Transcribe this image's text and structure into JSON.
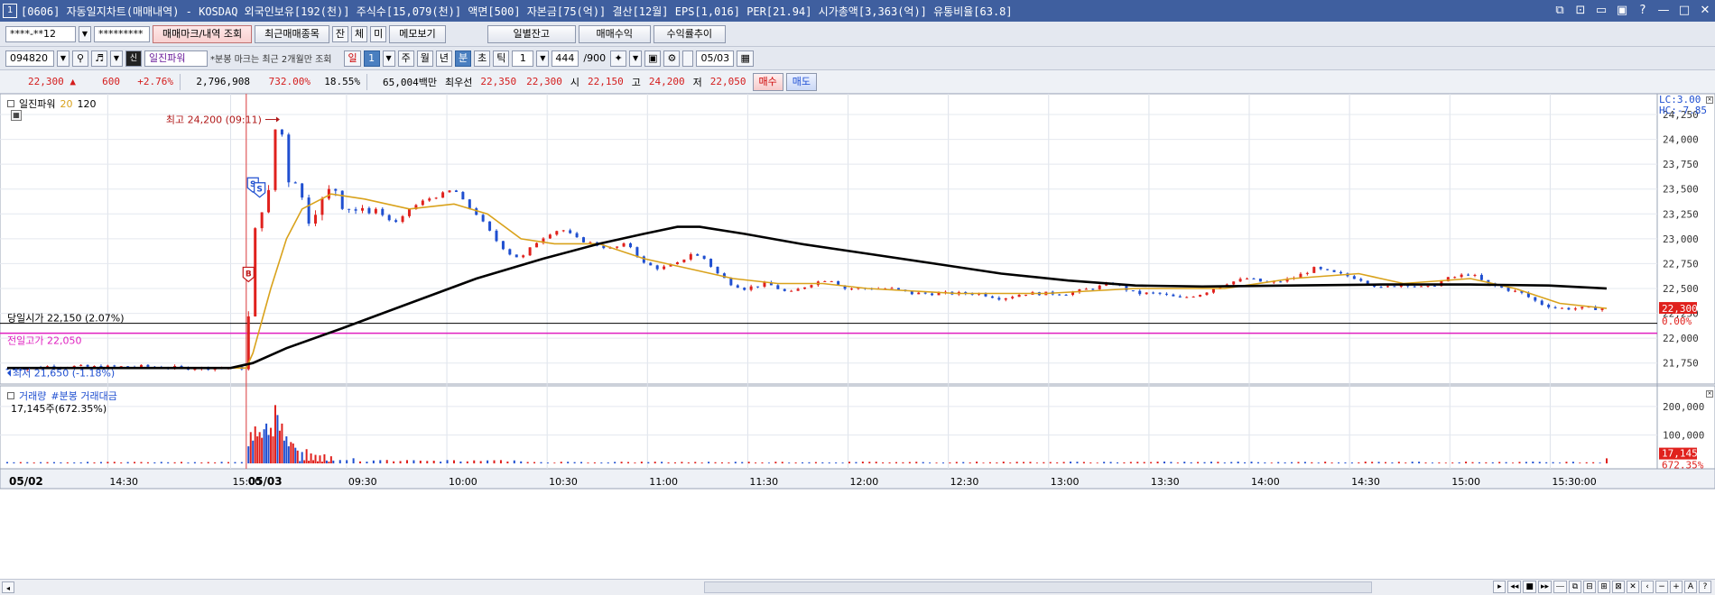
{
  "window": {
    "number": "1",
    "title": "[0606] 자동일지차트(매매내역) - KOSDAQ 외국인보유[192(천)] 주식수[15,079(천)] 액면[500] 자본금[75(억)] 결산[12월] EPS[1,016] PER[21.94] 시가총액[3,363(억)] 유통비율[63.8]",
    "controls": [
      "⧉",
      "⊡",
      "▭",
      "▣",
      "?",
      "—",
      "□",
      "✕"
    ]
  },
  "toolbar1": {
    "account": "****-**12",
    "password": "*********",
    "buttons": [
      "매매마크/내역 조회",
      "최근매매종목",
      "잔",
      "체",
      "미",
      "메모보기"
    ],
    "right_buttons": [
      "일별잔고",
      "매매수익",
      "수익률추이"
    ]
  },
  "toolbar2": {
    "code": "094820",
    "name": "일진파워",
    "note": "*분봉 마크는 최근 2개월만 조회",
    "period": "일",
    "period_num": "1",
    "period_tabs": [
      "주",
      "월",
      "년",
      "분",
      "초",
      "틱"
    ],
    "interval": "1",
    "count": "444",
    "count_total": "/900",
    "date": "05/03"
  },
  "quote": {
    "price": "22,300 ▲",
    "change": "600",
    "change_pct": "+2.76%",
    "volume": "2,796,908",
    "volume_ratio": "732.00%",
    "turnover_ratio": "18.55%",
    "amount": "65,004백만",
    "best_label": "최우선",
    "ask": "22,350",
    "bid": "22,300",
    "open_label": "시",
    "open": "22,150",
    "high_label": "고",
    "high": "24,200",
    "low_label": "저",
    "low": "22,050",
    "buy_button": "매수",
    "sell_button": "매도"
  },
  "colors": {
    "up": "#e0211d",
    "down": "#1f4fd0",
    "ma20": "#d9a21b",
    "ma120": "#000000",
    "prev_high_line": "#e020c0",
    "today_open_line": "#000000",
    "cursor_line": "#e04040",
    "accent_titlebar": "#3f5f9f"
  },
  "chart_data": [
    {
      "type": "candlestick",
      "title": "일진파워",
      "legend": [
        "20",
        "120"
      ],
      "ylim": [
        21575,
        24350
      ],
      "y_ticks": [
        24250,
        24000,
        23750,
        23500,
        23250,
        23000,
        22750,
        22500,
        22250,
        22000,
        21750
      ],
      "y_tick_labels": [
        "24,250",
        "24,000",
        "23,750",
        "23,500",
        "23,250",
        "23,000",
        "22,750",
        "22,500",
        "22,250",
        "22,000",
        "21,750"
      ],
      "x_labels": [
        {
          "t": "05/02 00",
          "label": "05/02"
        },
        {
          "t": "05/02 14:30",
          "label": "14:30"
        },
        {
          "t": "05/02 15:00",
          "label": "15:00"
        },
        {
          "t": "05/03 09:00",
          "label": "05/03"
        },
        {
          "t": "05/03 09:30",
          "label": "09:30"
        },
        {
          "t": "05/03 10:00",
          "label": "10:00"
        },
        {
          "t": "05/03 10:30",
          "label": "10:30"
        },
        {
          "t": "05/03 11:00",
          "label": "11:00"
        },
        {
          "t": "05/03 11:30",
          "label": "11:30"
        },
        {
          "t": "05/03 12:00",
          "label": "12:00"
        },
        {
          "t": "05/03 12:30",
          "label": "12:30"
        },
        {
          "t": "05/03 13:00",
          "label": "13:00"
        },
        {
          "t": "05/03 13:30",
          "label": "13:30"
        },
        {
          "t": "05/03 14:00",
          "label": "14:00"
        },
        {
          "t": "05/03 14:30",
          "label": "14:30"
        },
        {
          "t": "05/03 15:00",
          "label": "15:00"
        },
        {
          "t": "05/03 15:30",
          "label": "15:30:00"
        }
      ],
      "price_path": [
        [
          0,
          21690
        ],
        [
          10,
          21700
        ],
        [
          20,
          21720
        ],
        [
          40,
          21710
        ],
        [
          60,
          21715
        ],
        [
          80,
          21700
        ],
        [
          100,
          21700
        ],
        [
          107,
          21700
        ],
        [
          108,
          22200
        ],
        [
          109,
          22700
        ],
        [
          112,
          23250
        ],
        [
          115,
          23350
        ],
        [
          118,
          23500
        ],
        [
          120,
          24100
        ],
        [
          122,
          24200
        ],
        [
          124,
          23900
        ],
        [
          126,
          23600
        ],
        [
          128,
          23700
        ],
        [
          130,
          23500
        ],
        [
          132,
          23400
        ],
        [
          135,
          23200
        ],
        [
          138,
          23300
        ],
        [
          142,
          23400
        ],
        [
          146,
          23550
        ],
        [
          150,
          23350
        ],
        [
          155,
          23300
        ],
        [
          160,
          23250
        ],
        [
          165,
          23300
        ],
        [
          170,
          23200
        ],
        [
          175,
          23150
        ],
        [
          180,
          23300
        ],
        [
          188,
          23400
        ],
        [
          195,
          23450
        ],
        [
          200,
          23500
        ],
        [
          205,
          23350
        ],
        [
          210,
          23250
        ],
        [
          215,
          23100
        ],
        [
          220,
          22950
        ],
        [
          225,
          22850
        ],
        [
          230,
          22800
        ],
        [
          236,
          22950
        ],
        [
          242,
          23050
        ],
        [
          248,
          23100
        ],
        [
          255,
          23000
        ],
        [
          262,
          22950
        ],
        [
          270,
          22900
        ],
        [
          278,
          22950
        ],
        [
          285,
          22750
        ],
        [
          292,
          22700
        ],
        [
          300,
          22750
        ],
        [
          306,
          22850
        ],
        [
          312,
          22800
        ],
        [
          318,
          22650
        ],
        [
          324,
          22550
        ],
        [
          330,
          22500
        ],
        [
          340,
          22550
        ],
        [
          350,
          22450
        ],
        [
          360,
          22550
        ],
        [
          368,
          22600
        ],
        [
          375,
          22500
        ],
        [
          385,
          22500
        ],
        [
          395,
          22500
        ],
        [
          405,
          22450
        ],
        [
          415,
          22450
        ],
        [
          425,
          22450
        ],
        [
          435,
          22450
        ],
        [
          445,
          22400
        ],
        [
          455,
          22450
        ],
        [
          465,
          22450
        ],
        [
          475,
          22450
        ],
        [
          485,
          22500
        ],
        [
          495,
          22550
        ],
        [
          505,
          22450
        ],
        [
          515,
          22450
        ],
        [
          525,
          22400
        ],
        [
          535,
          22450
        ],
        [
          545,
          22550
        ],
        [
          555,
          22600
        ],
        [
          565,
          22550
        ],
        [
          575,
          22600
        ],
        [
          585,
          22700
        ],
        [
          595,
          22650
        ],
        [
          605,
          22600
        ],
        [
          615,
          22500
        ],
        [
          625,
          22550
        ],
        [
          635,
          22500
        ],
        [
          645,
          22600
        ],
        [
          655,
          22650
        ],
        [
          662,
          22550
        ],
        [
          670,
          22500
        ],
        [
          678,
          22450
        ],
        [
          686,
          22350
        ],
        [
          694,
          22300
        ],
        [
          702,
          22300
        ],
        [
          710,
          22300
        ],
        [
          716,
          22300
        ]
      ],
      "ma20_path": [
        [
          0,
          21700
        ],
        [
          107,
          21700
        ],
        [
          110,
          21850
        ],
        [
          118,
          22500
        ],
        [
          125,
          23000
        ],
        [
          132,
          23300
        ],
        [
          145,
          23450
        ],
        [
          160,
          23400
        ],
        [
          180,
          23300
        ],
        [
          200,
          23350
        ],
        [
          215,
          23250
        ],
        [
          230,
          23000
        ],
        [
          245,
          22950
        ],
        [
          265,
          22950
        ],
        [
          285,
          22800
        ],
        [
          305,
          22700
        ],
        [
          325,
          22600
        ],
        [
          345,
          22550
        ],
        [
          365,
          22550
        ],
        [
          385,
          22500
        ],
        [
          425,
          22450
        ],
        [
          465,
          22450
        ],
        [
          505,
          22500
        ],
        [
          545,
          22500
        ],
        [
          575,
          22600
        ],
        [
          605,
          22650
        ],
        [
          625,
          22550
        ],
        [
          655,
          22600
        ],
        [
          675,
          22500
        ],
        [
          695,
          22350
        ],
        [
          716,
          22300
        ]
      ],
      "ma120_path": [
        [
          0,
          21700
        ],
        [
          100,
          21700
        ],
        [
          110,
          21750
        ],
        [
          125,
          21900
        ],
        [
          150,
          22100
        ],
        [
          180,
          22350
        ],
        [
          210,
          22600
        ],
        [
          240,
          22800
        ],
        [
          265,
          22950
        ],
        [
          285,
          23050
        ],
        [
          300,
          23120
        ],
        [
          310,
          23120
        ],
        [
          330,
          23050
        ],
        [
          355,
          22950
        ],
        [
          385,
          22850
        ],
        [
          415,
          22750
        ],
        [
          445,
          22650
        ],
        [
          475,
          22580
        ],
        [
          505,
          22530
        ],
        [
          535,
          22520
        ],
        [
          575,
          22530
        ],
        [
          615,
          22540
        ],
        [
          655,
          22540
        ],
        [
          690,
          22530
        ],
        [
          716,
          22500
        ]
      ],
      "today_open": {
        "value": 22150,
        "label": "당일시가 22,150 (2.07%)"
      },
      "prev_high": {
        "value": 22050,
        "label": "전일고가 22,050"
      },
      "low_marker": {
        "value": 21650,
        "label": "최저 21,650 (-1.18%)"
      },
      "high_marker": {
        "value": 24200,
        "label": "최고 24,200 (09:11)"
      },
      "cursor_index": 107,
      "current_price": {
        "value": 22300,
        "label": "22,300",
        "pct": "0.00%"
      },
      "lc_label": "LC:3.00",
      "hc_label": "HC:-7.85",
      "trade_marks": [
        {
          "i": 108,
          "value": 22650,
          "mark": "B"
        },
        {
          "i": 110,
          "value": 23550,
          "mark": "S"
        },
        {
          "i": 113,
          "value": 23500,
          "mark": "S"
        }
      ]
    },
    {
      "type": "bar",
      "title": "거래량",
      "legend": [
        "거래량",
        "#분봉 거래대금"
      ],
      "readout": "17,145주(672.35%)",
      "ylim": [
        0,
        260000
      ],
      "y_ticks": [
        200000,
        100000
      ],
      "y_tick_labels": [
        "200,000",
        "100,000"
      ],
      "current_label": "17,145",
      "current_pct": "672.35%",
      "volume_samples": [
        [
          107,
          150000
        ],
        [
          108,
          60000
        ],
        [
          109,
          110000
        ],
        [
          110,
          80000
        ],
        [
          111,
          130000
        ],
        [
          112,
          95000
        ],
        [
          113,
          110000
        ],
        [
          114,
          90000
        ],
        [
          115,
          120000
        ],
        [
          116,
          140000
        ],
        [
          117,
          100000
        ],
        [
          118,
          125000
        ],
        [
          119,
          95000
        ],
        [
          120,
          205000
        ],
        [
          121,
          170000
        ],
        [
          122,
          115000
        ],
        [
          123,
          140000
        ],
        [
          124,
          80000
        ],
        [
          125,
          95000
        ],
        [
          126,
          60000
        ],
        [
          127,
          75000
        ],
        [
          128,
          70000
        ],
        [
          129,
          55000
        ],
        [
          130,
          45000
        ],
        [
          132,
          40000
        ],
        [
          134,
          50000
        ],
        [
          136,
          35000
        ],
        [
          138,
          30000
        ],
        [
          140,
          28000
        ],
        [
          142,
          32000
        ],
        [
          145,
          25000
        ],
        [
          150,
          22000
        ],
        [
          155,
          18000
        ],
        [
          160,
          20000
        ],
        [
          165,
          14000
        ],
        [
          170,
          12000
        ],
        [
          180,
          10000
        ],
        [
          190,
          9000
        ],
        [
          200,
          11000
        ],
        [
          210,
          8000
        ],
        [
          220,
          9000
        ],
        [
          230,
          7000
        ]
      ]
    }
  ],
  "scrollbar": {
    "controls": [
      "▸",
      "◂◂",
      "■",
      "▸▸",
      "⎯⎯",
      "⧉",
      "⊟",
      "⊞",
      "⊠",
      "✕",
      "‹",
      "−",
      "+",
      "A",
      "?"
    ]
  }
}
